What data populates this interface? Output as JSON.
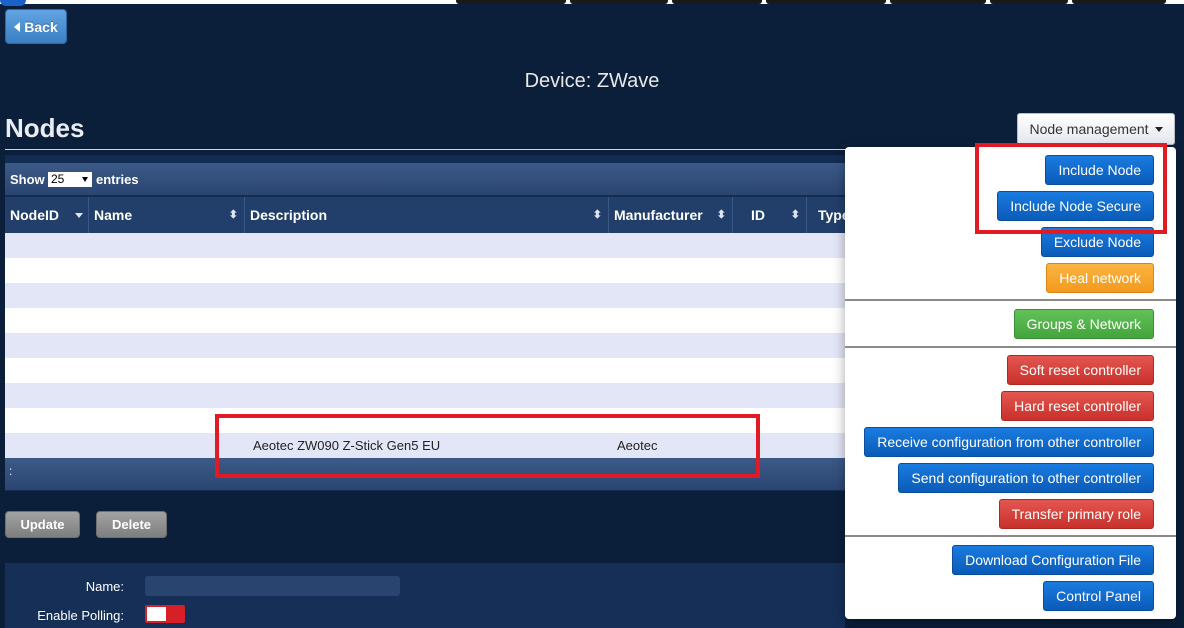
{
  "nav": {
    "back_label": "Back"
  },
  "page": {
    "device_title": "Device: ZWave",
    "section_title": "Nodes"
  },
  "node_management": {
    "button_label": "Node management",
    "menu": {
      "include_node": "Include Node",
      "include_node_secure": "Include Node Secure",
      "exclude_node": "Exclude Node",
      "heal_network": "Heal network",
      "groups_network": "Groups & Network",
      "soft_reset": "Soft reset controller",
      "hard_reset": "Hard reset controller",
      "receive_config": "Receive configuration from other controller",
      "send_config": "Send configuration to other controller",
      "transfer_primary": "Transfer primary role",
      "download_config": "Download Configuration File",
      "control_panel": "Control Panel"
    }
  },
  "table": {
    "show_label": "Show",
    "page_size": "25",
    "entries_label": "entries",
    "columns": [
      "NodeID",
      "Name",
      "Description",
      "Manufacturer",
      "ID",
      "Type"
    ],
    "rows": [
      {
        "description": "",
        "manufacturer": ""
      },
      {
        "description": "",
        "manufacturer": ""
      },
      {
        "description": "",
        "manufacturer": ""
      },
      {
        "description": "",
        "manufacturer": ""
      },
      {
        "description": "",
        "manufacturer": ""
      },
      {
        "description": "",
        "manufacturer": ""
      },
      {
        "description": "",
        "manufacturer": ""
      },
      {
        "description": "",
        "manufacturer": ""
      },
      {
        "description": "Aeotec ZW090 Z-Stick Gen5 EU",
        "manufacturer": "Aeotec"
      }
    ],
    "footer_text": ":"
  },
  "actions": {
    "update_label": "Update",
    "delete_label": "Delete"
  },
  "form": {
    "name_label": "Name:",
    "name_value": "",
    "polling_label": "Enable Polling:"
  },
  "colors": {
    "accent_blue": "#0a5bb8",
    "highlight_red": "#e01b24",
    "background": "#0b1f3a"
  }
}
